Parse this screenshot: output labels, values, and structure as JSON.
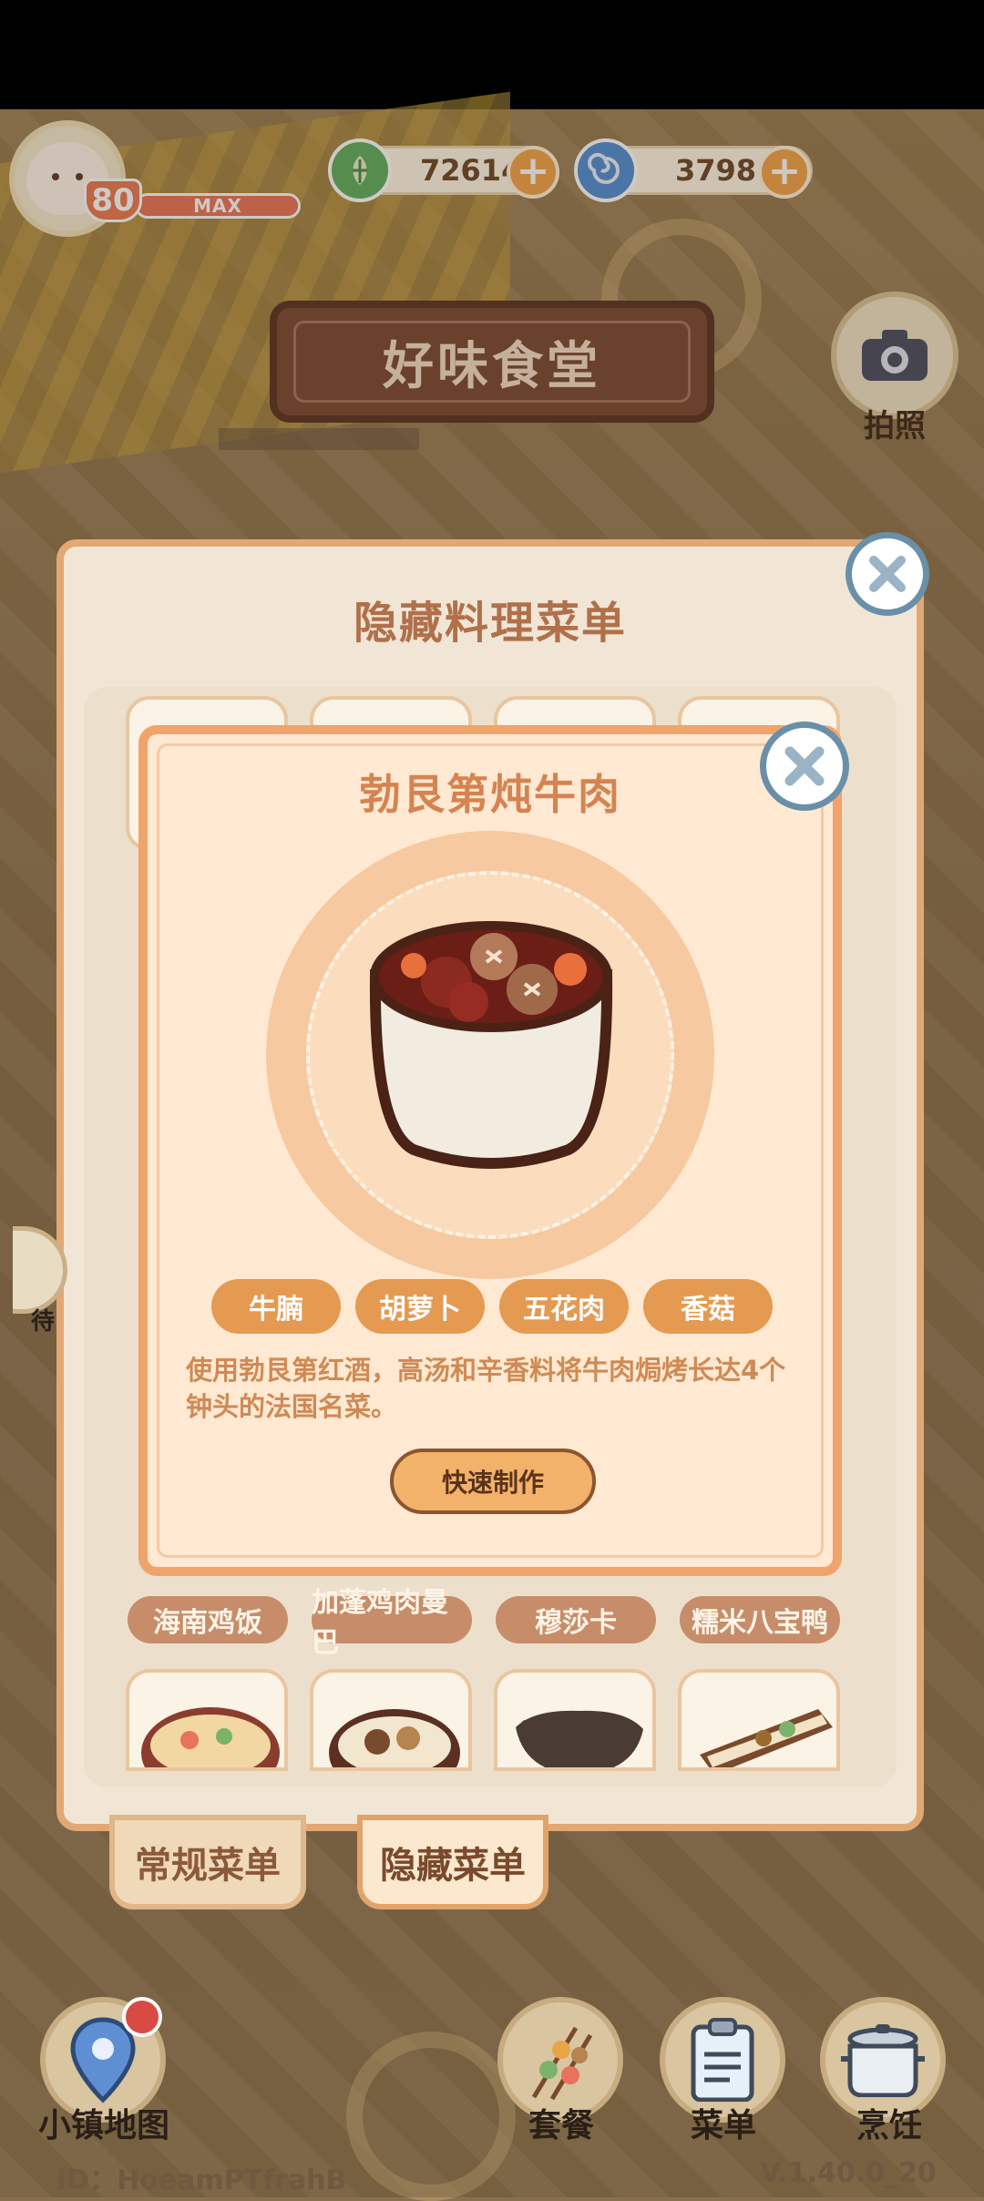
{
  "hud": {
    "level": "80",
    "xp_label": "MAX",
    "xp_fill": 1.0,
    "currency_green": "72614",
    "currency_blue": "3798",
    "plus_symbol": "+"
  },
  "restaurant_title": "好味食堂",
  "camera_label": "拍照",
  "outer_panel": {
    "title": "隐藏料理菜单",
    "row_labels": [
      "海南鸡饭",
      "加蓬鸡肉曼巴",
      "穆莎卡",
      "糯米八宝鸭"
    ]
  },
  "tabs": {
    "regular": "常规菜单",
    "hidden": "隐藏菜单"
  },
  "dish": {
    "title": "勃艮第炖牛肉",
    "ingredients": [
      "牛腩",
      "胡萝卜",
      "五花肉",
      "香菇"
    ],
    "description": "使用勃艮第红酒，高汤和辛香料将牛肉焗烤长达4个钟头的法国名菜。",
    "make_button": "快速制作"
  },
  "bottom_nav": {
    "map": "小镇地图",
    "set_meal": "套餐",
    "menu": "菜单",
    "cook": "烹饪"
  },
  "side_partial_label": "待",
  "footer": {
    "id": "ID：HoeamPTfrahB",
    "version": "V.1.40.0_20"
  },
  "colors": {
    "accent_orange": "#e59a52",
    "panel_border": "#f0a36b",
    "title_brown": "#b0704a",
    "close_blue": "#6a8fa8"
  }
}
